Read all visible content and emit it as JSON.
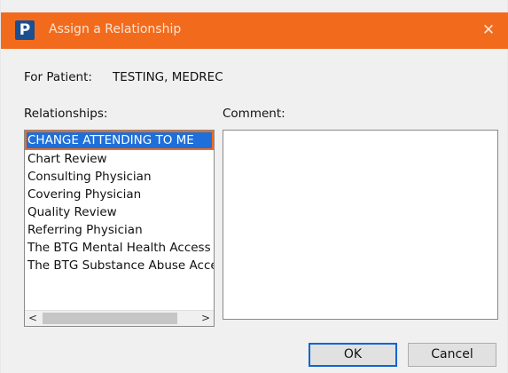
{
  "window": {
    "title": "Assign a Relationship",
    "app_icon_letter": "P",
    "close_glyph": "✕"
  },
  "patient": {
    "label": "For Patient:",
    "name": "TESTING, MEDREC"
  },
  "relationships": {
    "label": "Relationships:",
    "items": [
      {
        "label": "CHANGE ATTENDING TO ME",
        "selected": true
      },
      {
        "label": "Chart Review",
        "selected": false
      },
      {
        "label": "Consulting Physician",
        "selected": false
      },
      {
        "label": "Covering Physician",
        "selected": false
      },
      {
        "label": "Quality Review",
        "selected": false
      },
      {
        "label": "Referring Physician",
        "selected": false
      },
      {
        "label": "The BTG Mental Health Access",
        "selected": false
      },
      {
        "label": "The BTG Substance Abuse Access",
        "selected": false
      }
    ],
    "scroll_left_glyph": "<",
    "scroll_right_glyph": ">"
  },
  "comment": {
    "label": "Comment:",
    "value": ""
  },
  "buttons": {
    "ok": "OK",
    "cancel": "Cancel"
  },
  "colors": {
    "titlebar": "#f26b1d",
    "selection": "#1e6fd9",
    "focus_outline": "#f26b1d",
    "default_button_border": "#0a64d6"
  }
}
